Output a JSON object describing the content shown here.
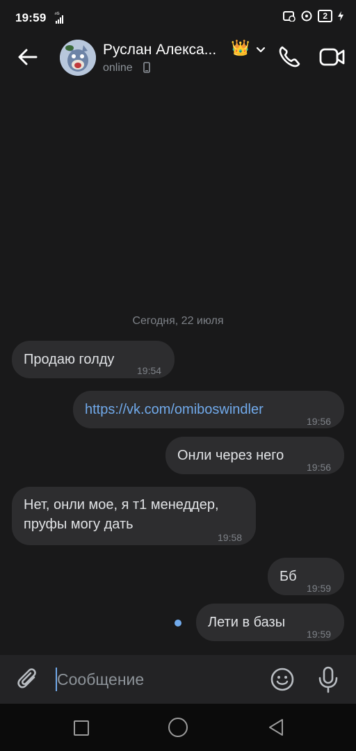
{
  "status_bar": {
    "time": "19:59",
    "network": "⁴ᴳ",
    "battery": "2"
  },
  "header": {
    "contact_name": "Руслан Алекса...",
    "crown": "👑",
    "status": "online"
  },
  "chat": {
    "date_separator": "Сегодня, 22 июля",
    "messages": [
      {
        "text": "Продаю голду",
        "time": "19:54",
        "direction": "in"
      },
      {
        "text": "https://vk.com/omiboswindler",
        "time": "19:56",
        "direction": "out",
        "is_link": true
      },
      {
        "text": "Онли через него",
        "time": "19:56",
        "direction": "out"
      },
      {
        "text": "Нет, онли мое, я т1 менеддер, пруфы могу дать",
        "time": "19:58",
        "direction": "in"
      },
      {
        "text": "Бб",
        "time": "19:59",
        "direction": "out"
      },
      {
        "text": "Лети в базы",
        "time": "19:59",
        "direction": "out",
        "unread": true
      }
    ]
  },
  "composer": {
    "placeholder": "Сообщение"
  },
  "colors": {
    "background": "#19191a",
    "bubble": "#2d2d2f",
    "accent": "#71aaeb",
    "muted": "#7e8288"
  },
  "icons": [
    "back-arrow-icon",
    "chevron-down-icon",
    "phone-icon",
    "video-camera-icon",
    "paperclip-icon",
    "emoji-icon",
    "microphone-icon"
  ]
}
